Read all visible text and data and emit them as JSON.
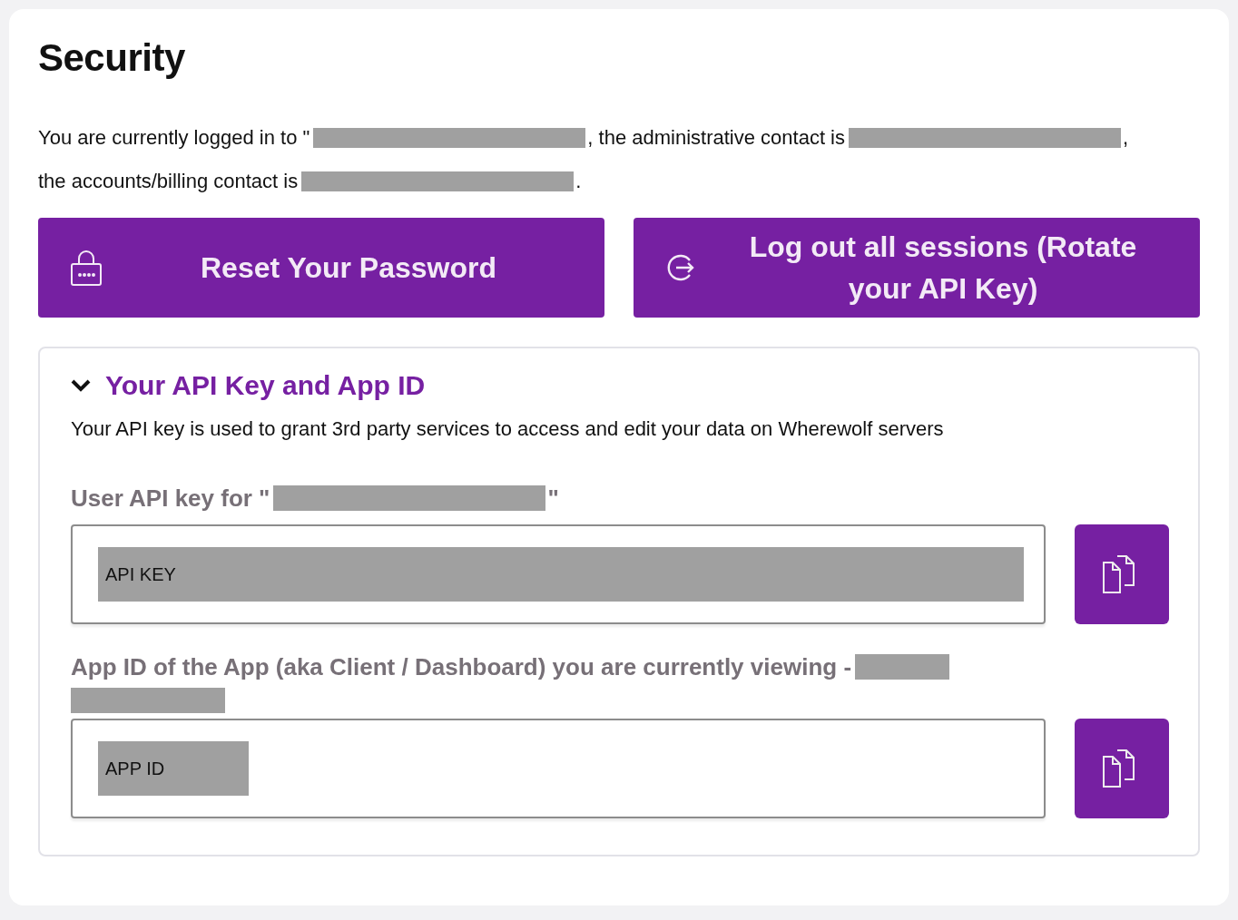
{
  "title": "Security",
  "intro": [
    {
      "kind": "text",
      "text": "You are currently logged in to \""
    },
    {
      "kind": "redacted"
    },
    {
      "kind": "text",
      "text": ", the administrative contact is"
    },
    {
      "kind": "redacted"
    },
    {
      "kind": "text",
      "text": ","
    },
    {
      "kind": "text",
      "text": "the accounts/billing contact is"
    },
    {
      "kind": "redacted"
    },
    {
      "kind": "text",
      "text": "."
    }
  ],
  "actions": [
    {
      "label": "Reset Your Password"
    },
    {
      "label": "Log out all sessions (Rotate your API Key)"
    }
  ],
  "api_panel": {
    "title": "Your API Key and App ID",
    "expanded": true,
    "description": "Your API key is used to grant 3rd party services to access and edit your data on Wherewolf servers",
    "fields": [
      {
        "label": [
          {
            "kind": "text",
            "text": "User API key for \""
          },
          {
            "kind": "redacted"
          },
          {
            "kind": "text",
            "text": "\""
          }
        ],
        "value": "API KEY",
        "wide": true
      },
      {
        "label": [
          {
            "kind": "text",
            "text": "App ID of the App (aka Client / Dashboard) you are currently viewing -"
          },
          {
            "kind": "redacted"
          },
          {
            "kind": "redacted"
          }
        ],
        "value": "APP ID",
        "wide": false
      }
    ]
  }
}
